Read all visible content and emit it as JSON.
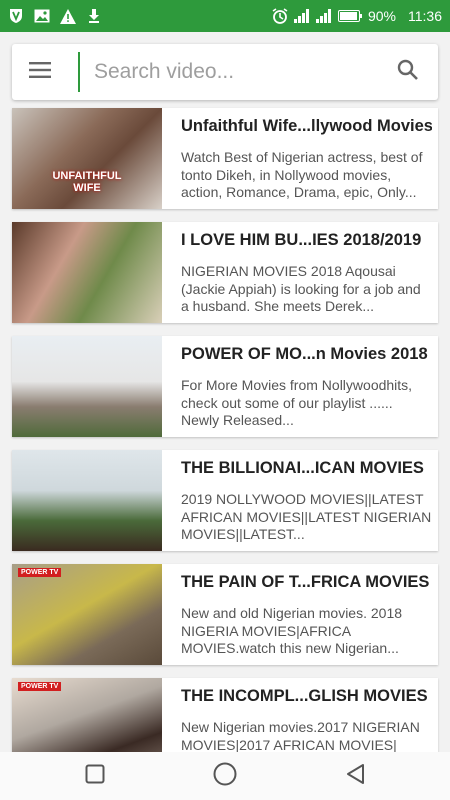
{
  "statusbar": {
    "left_icons": [
      "shield-app-icon",
      "image-notification-icon",
      "warning-icon",
      "download-icon"
    ],
    "right_icons": [
      "alarm-icon",
      "signal-icon",
      "signal-icon",
      "battery-icon"
    ],
    "battery": "90%",
    "time": "11:36",
    "color": "#2e9a3c"
  },
  "search": {
    "placeholder": "Search video..."
  },
  "videos": [
    {
      "title": "Unfaithful Wife...llywood Movies",
      "description": "Watch Best of Nigerian actress, best of tonto Dikeh, in Nollywood movies, action, Romance, Drama, epic, Only...",
      "thumb_text": "UNFAITHFUL WIFE",
      "thumb_colors": [
        "#b8b0a8",
        "#7a5c4a",
        "#d8d0c8"
      ]
    },
    {
      "title": "I LOVE HIM BU...IES 2018/2019",
      "description": "NIGERIAN MOVIES 2018 Aqousai (Jackie Appiah) is looking for a job and a husband. She meets Derek...",
      "thumb_text": "",
      "thumb_colors": [
        "#6f8a4a",
        "#5a3a2a",
        "#c89a88"
      ]
    },
    {
      "title": "POWER OF MO...n Movies 2018",
      "description": "For More Movies from Nollywoodhits, check out some of our playlist ...... Newly Released...",
      "thumb_text": "",
      "thumb_colors": [
        "#e6e6e6",
        "#8a7d70",
        "#6a5040"
      ]
    },
    {
      "title": "THE BILLIONAI...ICAN MOVIES",
      "description": "2019 NOLLYWOOD MOVIES||LATEST AFRICAN MOVIES||LATEST NIGERIAN MOVIES||LATEST...",
      "thumb_text": "",
      "thumb_colors": [
        "#cfd8dc",
        "#4a6a3a",
        "#3a2a20"
      ]
    },
    {
      "title": "THE PAIN OF T...FRICA MOVIES",
      "description": "New and old Nigerian movies. 2018 NIGERIA MOVIES|AFRICA MOVIES.watch this new Nigerian...",
      "thumb_text": "POWER TV",
      "thumb_colors": [
        "#9a8e78",
        "#c8b84a",
        "#5a4a3a"
      ]
    },
    {
      "title": "THE INCOMPL...GLISH MOVIES",
      "description": "New Nigerian movies.2017 NIGERIAN MOVIES|2017 AFRICAN MOVIES|",
      "thumb_text": "POWER TV",
      "thumb_colors": [
        "#b0a8a0",
        "#3a2a24",
        "#e8dcd0"
      ]
    }
  ],
  "navbar": {
    "icons": [
      "recent-apps-icon",
      "home-icon",
      "back-icon"
    ]
  }
}
